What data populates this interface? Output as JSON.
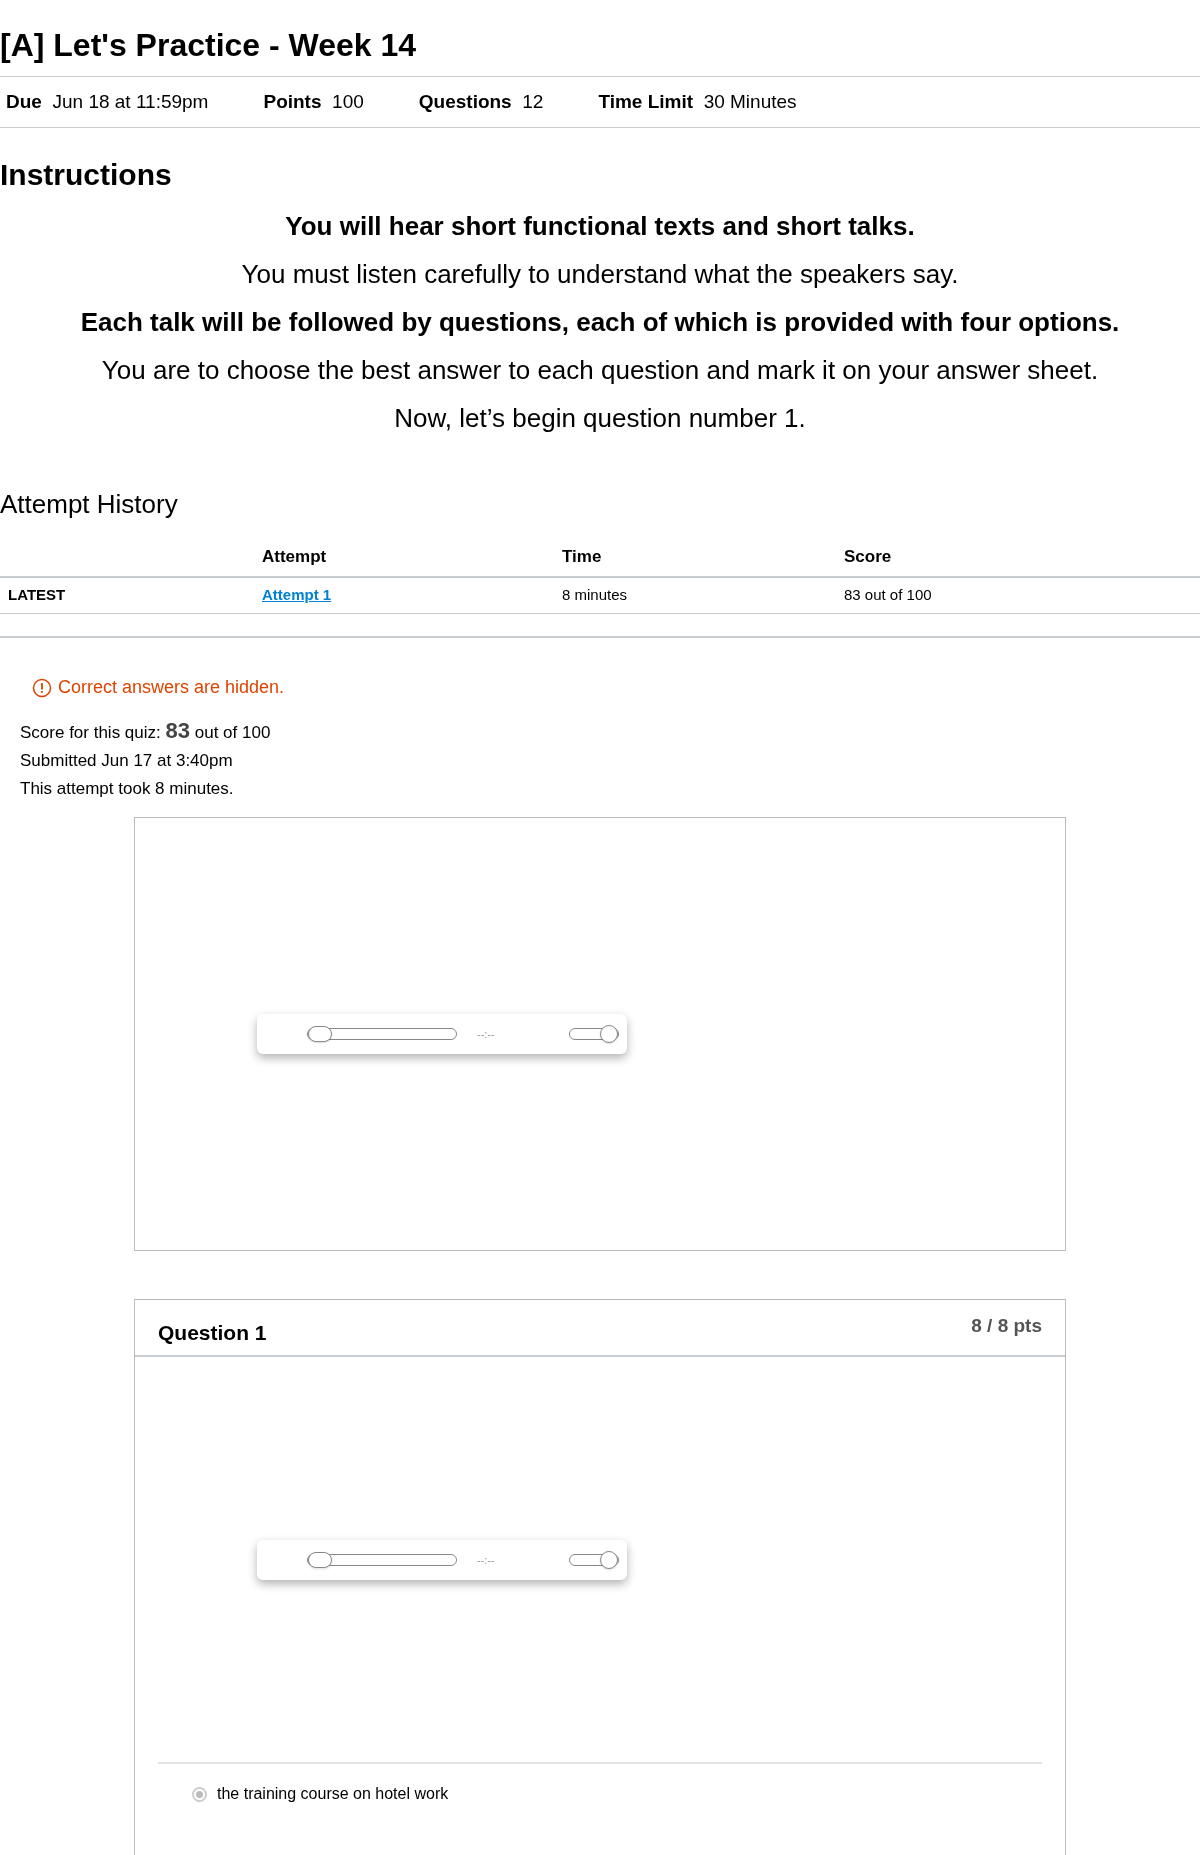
{
  "title": "[A] Let's Practice - Week 14",
  "details": [
    {
      "label": "Due",
      "value": "Jun 18 at 11:59pm"
    },
    {
      "label": "Points",
      "value": "100"
    },
    {
      "label": "Questions",
      "value": "12"
    },
    {
      "label": "Time Limit",
      "value": "30 Minutes"
    }
  ],
  "instructions": {
    "heading": "Instructions",
    "lines": [
      {
        "text": "You will hear short functional texts and short talks.",
        "bold": true
      },
      {
        "text": "You must listen carefully to understand what the speakers say.",
        "bold": false
      },
      {
        "text": "Each talk will be followed by questions, each of which is provided with four options.",
        "bold": true
      },
      {
        "text": "You are to choose the best answer to each question and mark it on your answer sheet.",
        "bold": false
      },
      {
        "text": "Now, let’s begin question number 1.",
        "bold": false
      }
    ]
  },
  "attempt_history": {
    "heading": "Attempt History",
    "columns": [
      "Attempt",
      "Time",
      "Score"
    ],
    "rows": [
      {
        "label": "LATEST",
        "attempt": "Attempt 1",
        "time": "8 minutes",
        "score": "83 out of 100"
      }
    ]
  },
  "notice": "Correct answers are hidden.",
  "summary": {
    "score_label": "Score for this quiz:",
    "score": "83",
    "score_total": "out of 100",
    "submitted": "Submitted Jun 17 at 3:40pm",
    "duration": "This attempt took 8 minutes."
  },
  "audio_players": [
    {
      "time": "--:--",
      "seek": {
        "level": 0
      },
      "volume": {
        "level": 1
      }
    }
  ],
  "question": {
    "title": "Question 1",
    "points": "8 / 8 pts",
    "audio": {
      "time": "--:--",
      "seek": {
        "level": 0
      },
      "volume": {
        "level": 1
      }
    },
    "answers": [
      {
        "text": "the training course on hotel work",
        "selected": true
      }
    ]
  }
}
